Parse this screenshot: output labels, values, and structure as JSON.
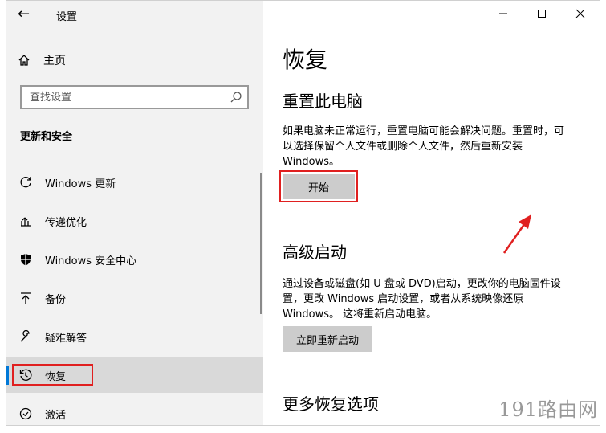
{
  "app": {
    "title": "设置",
    "back_label": "←"
  },
  "window_controls": {
    "minimize": "—",
    "maximize": "☐",
    "close": "✕"
  },
  "sidebar": {
    "home_label": "主页",
    "search_placeholder": "查找设置",
    "section_title": "更新和安全",
    "items": [
      {
        "label": "Windows 更新",
        "icon": "refresh-icon"
      },
      {
        "label": "传递优化",
        "icon": "delivery-icon"
      },
      {
        "label": "Windows 安全中心",
        "icon": "shield-icon"
      },
      {
        "label": "备份",
        "icon": "upload-arrow-icon"
      },
      {
        "label": "疑难解答",
        "icon": "wrench-icon"
      },
      {
        "label": "恢复",
        "icon": "history-icon",
        "active": true
      },
      {
        "label": "激活",
        "icon": "check-circle-icon"
      }
    ]
  },
  "main": {
    "page_title": "恢复",
    "reset": {
      "heading": "重置此电脑",
      "description": "如果电脑未正常运行，重置电脑可能会解决问题。重置时，可以选择保留个人文件或删除个人文件，然后重新安装 Windows。",
      "button_label": "开始"
    },
    "advanced": {
      "heading": "高级启动",
      "description": "通过设备或磁盘(如 U 盘或 DVD)启动，更改你的电脑固件设置，更改 Windows 启动设置，或者从系统映像还原 Windows。 这将重新启动电脑。",
      "button_label": "立即重新启动"
    },
    "more_heading": "更多恢复选项"
  },
  "watermark": "191路由网",
  "colors": {
    "accent": "#0078d7",
    "highlight_red": "#e02020",
    "sidebar_bg": "#f2f2f2",
    "button_bg": "#cccccc"
  }
}
